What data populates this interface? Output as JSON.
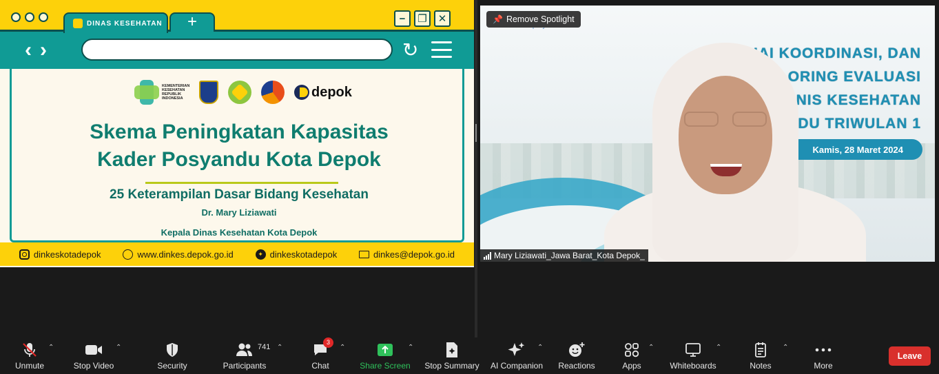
{
  "share": {
    "browser_tab_title": "DINAS KESEHATAN",
    "new_tab_glyph": "+",
    "window_buttons": {
      "minimize": "−",
      "maximize": "❐",
      "close": "✕"
    },
    "slide": {
      "logo_kemenkes_text": "KEMENTERIAN KESEHATAN REPUBLIK INDONESIA",
      "logo_depok_text": "depok",
      "title_line1": "Skema Peningkatan Kapasitas",
      "title_line2": "Kader Posyandu Kota Depok",
      "subtitle": "25 Keterampilan Dasar Bidang Kesehatan",
      "speaker": "Dr. Mary Liziawati",
      "role": "Kepala Dinas Kesehatan Kota Depok"
    },
    "footer": {
      "instagram": "dinkeskotadepok",
      "website": "www.dinkes.depok.go.id",
      "twitter": "dinkeskotadepok",
      "email": "dinkes@depok.go.id"
    }
  },
  "video": {
    "remove_spotlight": "Remove Spotlight",
    "participant_name": "Mary Liziawati_Jawa Barat_Kota Depok_",
    "background": {
      "logo_sub": "posyandu",
      "line1": "SOSIAI      KOORDINASI, DAN",
      "line2": "ORING EVALUASI",
      "line3": "PEM             NIS KESEHATAN",
      "line4": "B                  DU TRIWULAN 1",
      "date": "Kamis, 28 Maret 2024"
    }
  },
  "toolbar": {
    "unmute": "Unmute",
    "stop_video": "Stop Video",
    "security": "Security",
    "participants": "Participants",
    "participants_count": "741",
    "chat": "Chat",
    "chat_badge": "3",
    "share_screen": "Share Screen",
    "stop_summary": "Stop Summary",
    "ai_companion": "AI Companion",
    "reactions": "Reactions",
    "apps": "Apps",
    "whiteboards": "Whiteboards",
    "notes": "Notes",
    "more": "More",
    "leave": "Leave",
    "share_accent": "#2fc15b",
    "leave_color": "#d9302c"
  }
}
